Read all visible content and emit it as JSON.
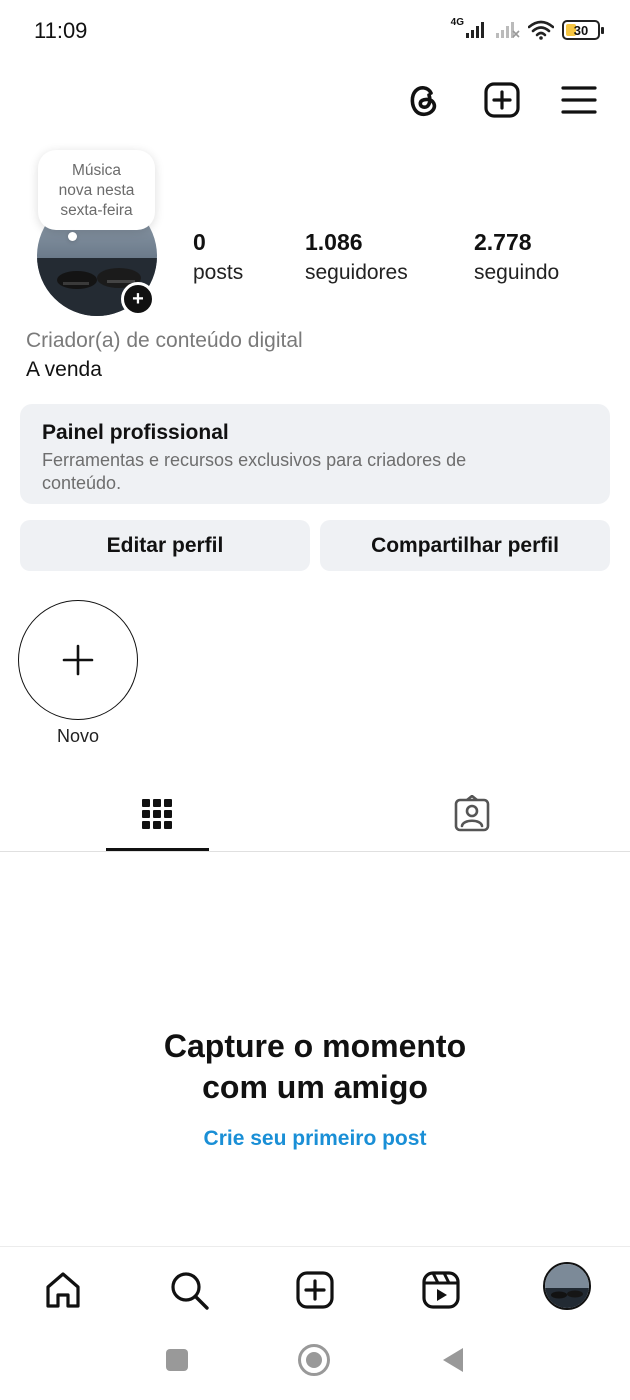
{
  "status_bar": {
    "time": "11:09",
    "network": "4G",
    "battery": "30",
    "icons": [
      "signal-icon",
      "signal-off-icon",
      "wifi-icon",
      "battery-icon"
    ]
  },
  "header": {
    "icons": [
      "threads-icon",
      "create-post-icon",
      "menu-icon"
    ]
  },
  "profile": {
    "note_lines": [
      "Música",
      "nova nesta",
      "sexta-feira"
    ],
    "stats": [
      {
        "value": "0",
        "label": "posts"
      },
      {
        "value": "1.086",
        "label": "seguidores"
      },
      {
        "value": "2.778",
        "label": "seguindo"
      }
    ],
    "category": "Criador(a) de conteúdo digital",
    "bio": "A venda"
  },
  "panel": {
    "title": "Painel profissional",
    "description_lines": [
      "Ferramentas e recursos exclusivos para criadores de",
      "conteúdo."
    ]
  },
  "buttons": {
    "edit": "Editar perfil",
    "share": "Compartilhar perfil"
  },
  "highlight": {
    "label": "Novo"
  },
  "tabs": [
    {
      "name": "grid",
      "icon": "grid-icon",
      "active": true
    },
    {
      "name": "tagged",
      "icon": "tagged-icon",
      "active": false
    }
  ],
  "empty_state": {
    "title_lines": [
      "Capture o momento",
      "com um amigo"
    ],
    "link": "Crie seu primeiro post"
  },
  "bottom_nav": [
    "home-icon",
    "search-icon",
    "create-icon",
    "reels-icon",
    "profile-avatar"
  ],
  "system_nav": [
    "recents-button",
    "home-button",
    "back-button"
  ],
  "colors": {
    "accent_link": "#1a8fd6",
    "panel_bg": "#eff1f4",
    "battery_fill": "#f5c542"
  }
}
